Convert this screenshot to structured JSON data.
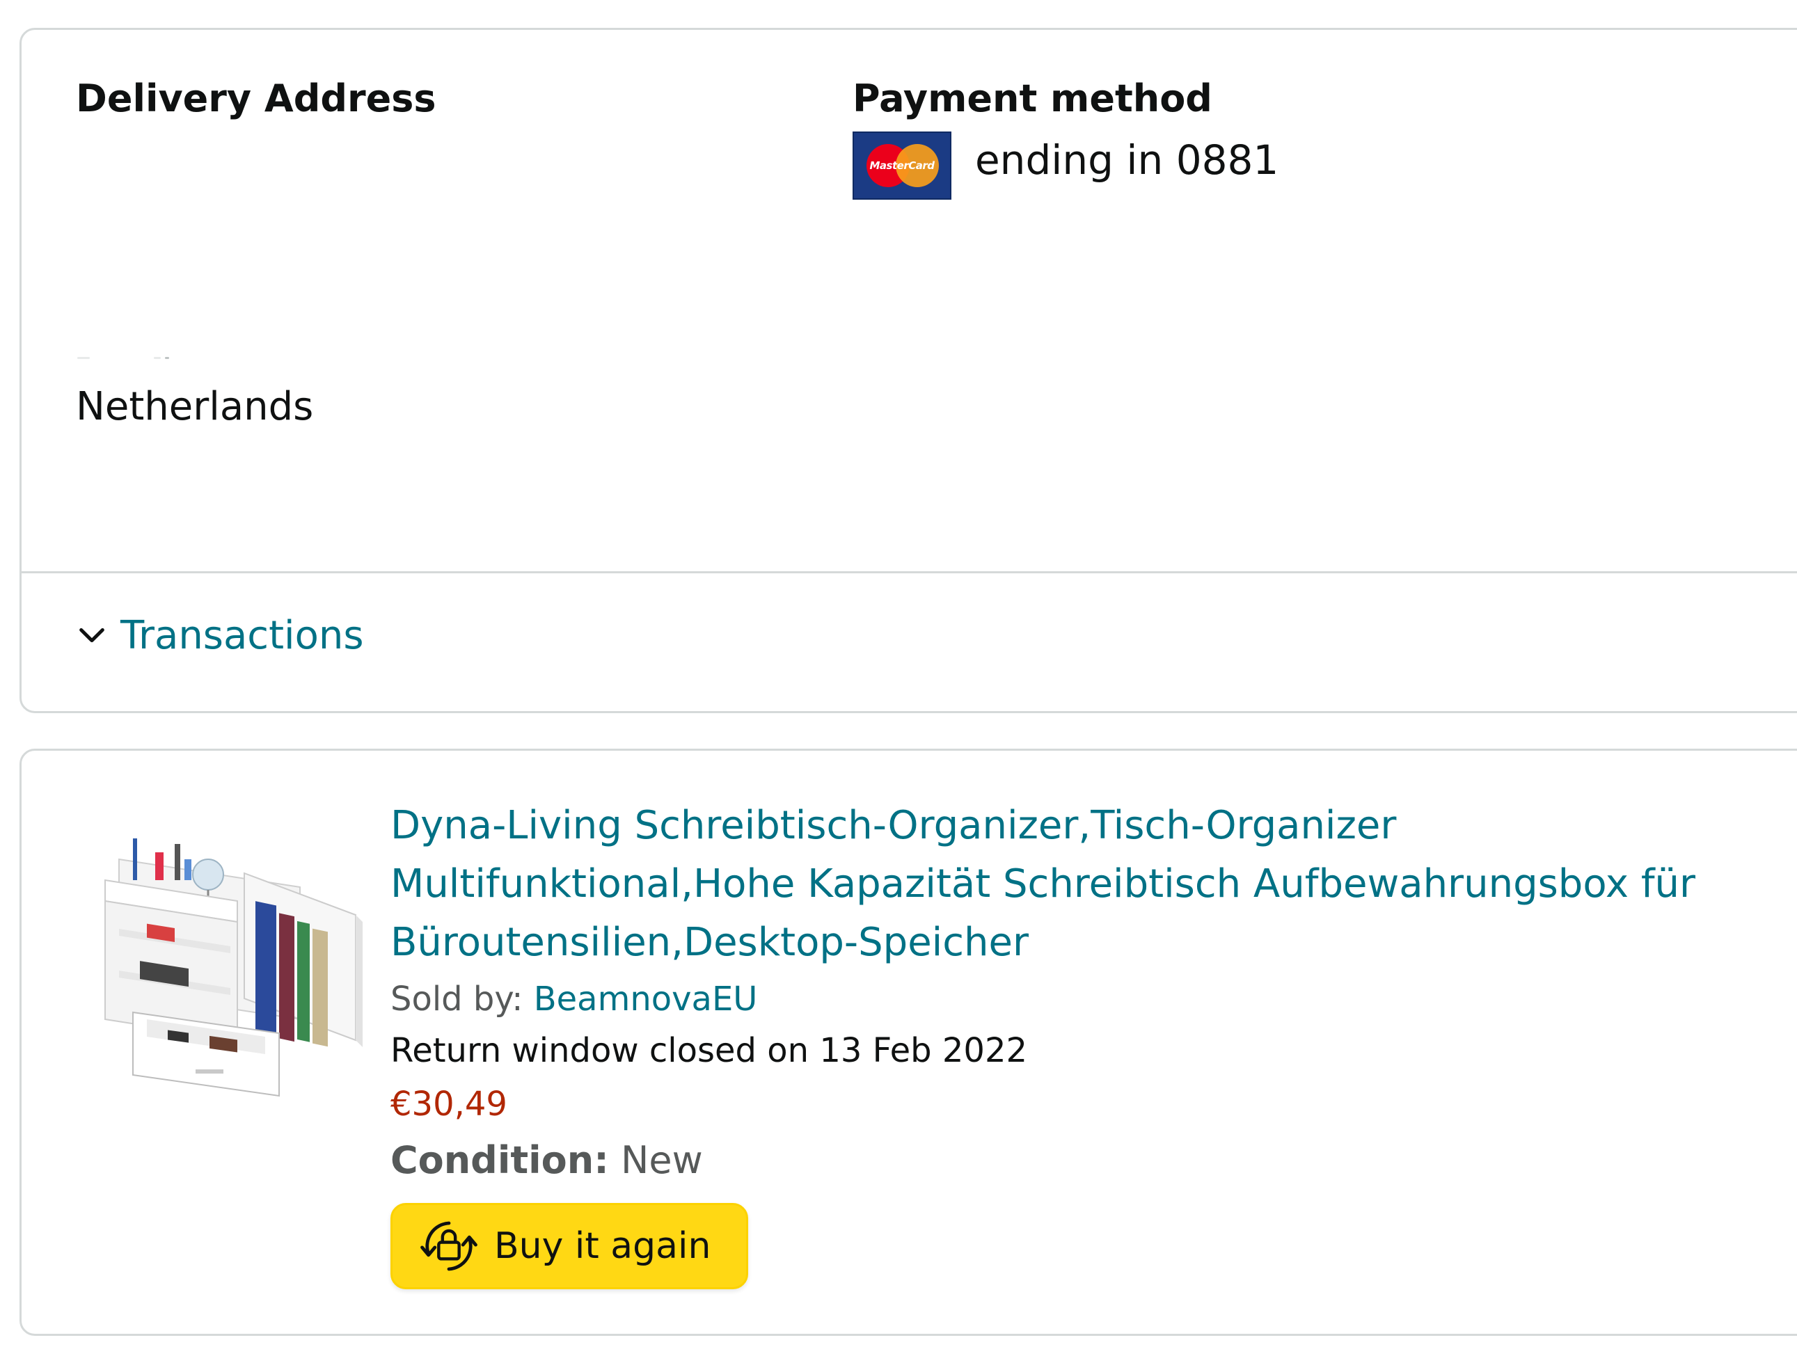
{
  "order_info": {
    "delivery_heading": "Delivery Address",
    "address_country": "Netherlands",
    "payment_heading": "Payment method",
    "card_brand_icon": "mastercard-icon",
    "card_brand_text": "MasterCard",
    "payment_ending": "ending in 0881",
    "transactions_label": "Transactions",
    "transactions_icon": "chevron-down-icon"
  },
  "item": {
    "image_icon": "desk-organizer-product-image",
    "title": "Dyna-Living Schreibtisch-Organizer,Tisch-Organizer Multifunktional,Hohe Kapazität Schreibtisch Aufbewahrungsbox für Büroutensilien,Desktop-Speicher",
    "sold_by_label": "Sold by: ",
    "seller_name": "BeamnovaEU",
    "return_window": "Return window closed on 13 Feb 2022",
    "price": "€30,49",
    "condition_label": "Condition:",
    "condition_value": " New",
    "buy_again_label": "Buy it again",
    "buy_again_icon": "buy-again-icon"
  },
  "colors": {
    "link": "#007185",
    "price": "#b12704",
    "button_bg": "#ffd814",
    "border": "#d5d9d9",
    "text": "#0f1111",
    "secondary_text": "#565959"
  }
}
